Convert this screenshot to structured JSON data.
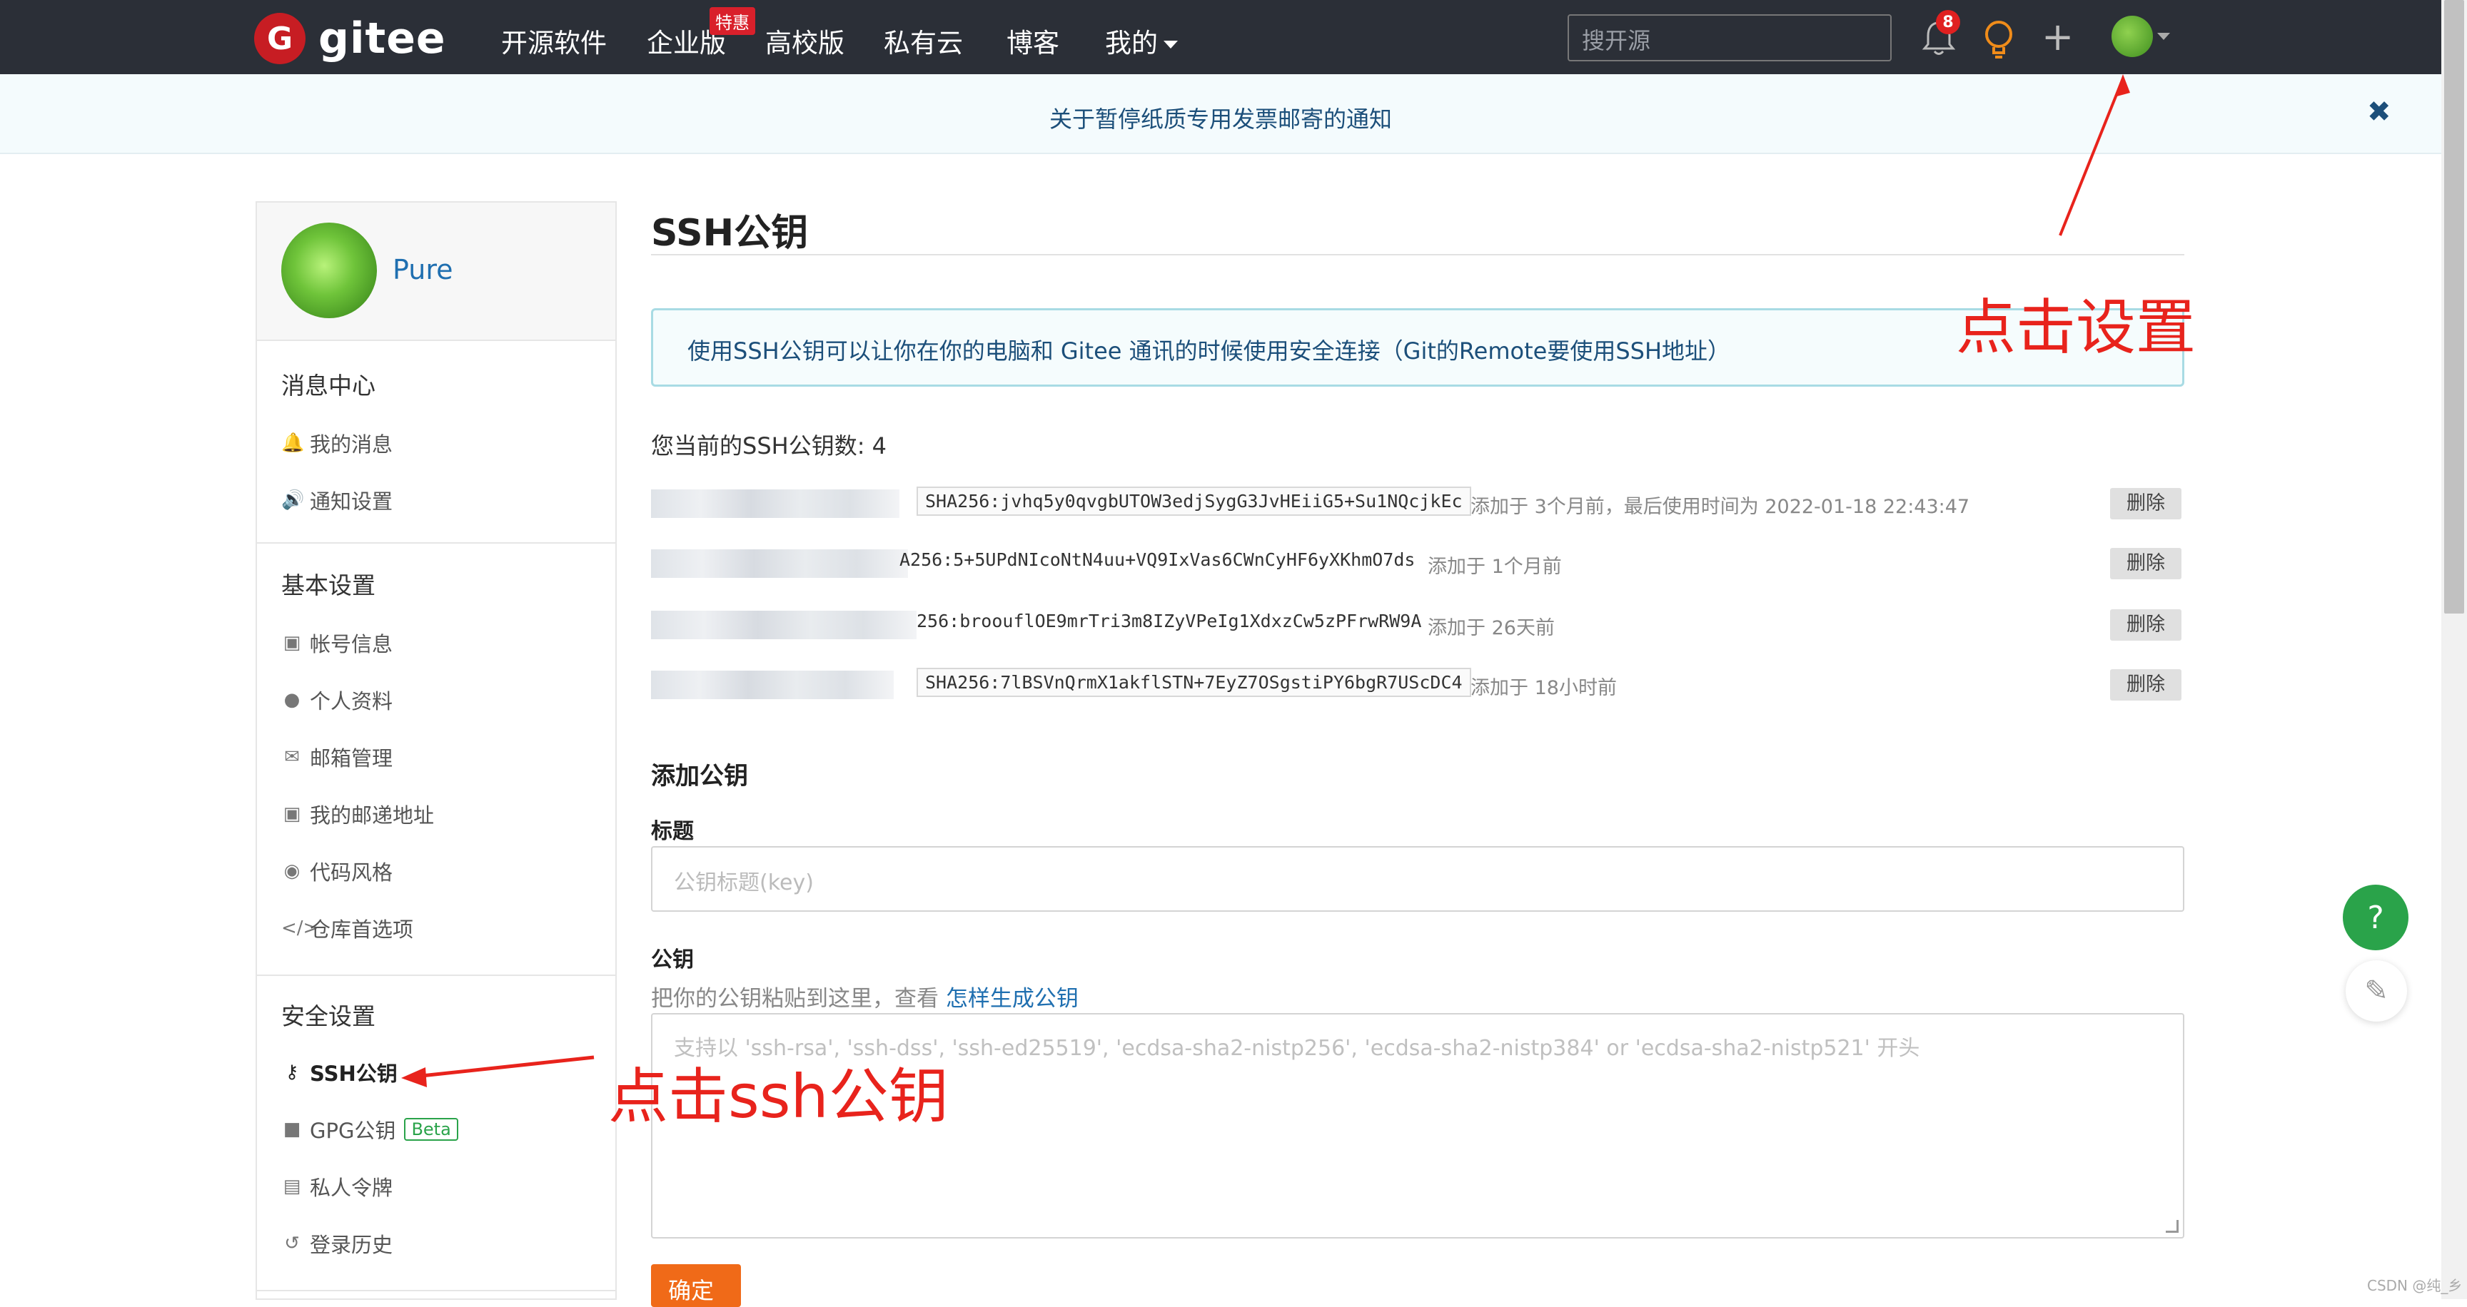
{
  "colors": {
    "accent": "#c71d23",
    "topbar": "#2b2f37",
    "link": "#1f6fb0",
    "annotation": "#e8231c",
    "submit": "#f06a18",
    "help": "#2aa34a"
  },
  "header": {
    "logo_letter": "G",
    "logo_text": "gitee",
    "nav": [
      "开源软件",
      "企业版",
      "高校版",
      "私有云",
      "博客"
    ],
    "enterprise_badge": "特惠",
    "my_menu": "我的",
    "search_placeholder": "搜开源",
    "notification_count": "8",
    "plus_icon": "+"
  },
  "notice": {
    "text": "关于暂停纸质专用发票邮寄的通知",
    "close": "✖"
  },
  "sidebar": {
    "username": "Pure",
    "sections": [
      {
        "title": "消息中心",
        "items": [
          {
            "icon": "bell-icon",
            "label": "我的消息"
          },
          {
            "icon": "volume-icon",
            "label": "通知设置"
          }
        ]
      },
      {
        "title": "基本设置",
        "items": [
          {
            "icon": "id-card-icon",
            "label": "帐号信息"
          },
          {
            "icon": "user-icon",
            "label": "个人资料"
          },
          {
            "icon": "mail-icon",
            "label": "邮箱管理"
          },
          {
            "icon": "address-icon",
            "label": "我的邮递地址"
          },
          {
            "icon": "palette-icon",
            "label": "代码风格"
          },
          {
            "icon": "code-icon",
            "label": "仓库首选项"
          }
        ]
      },
      {
        "title": "安全设置",
        "items": [
          {
            "icon": "key-icon",
            "label": "SSH公钥"
          },
          {
            "icon": "lock-icon",
            "label": "GPG公钥",
            "badge": "Beta"
          },
          {
            "icon": "token-icon",
            "label": "私人令牌"
          },
          {
            "icon": "history-icon",
            "label": "登录历史"
          }
        ]
      }
    ]
  },
  "main": {
    "title": "SSH公钥",
    "info": "使用SSH公钥可以让你在你的电脑和 Gitee 通讯的时候使用安全连接（Git的Remote要使用SSH地址）",
    "key_count": "您当前的SSH公钥数: 4",
    "keys": [
      {
        "fingerprint": "SHA256:jvhq5y0qvgbUTOW3edjSygG3JvHEiiG5+Su1NQcjkEc",
        "meta": "添加于 3个月前，最后使用时间为 2022-01-18 22:43:47",
        "delete": "删除"
      },
      {
        "fingerprint": "A256:5+5UPdNIcoNtN4uu+VQ9IxVas6CWnCyHF6yXKhmO7ds",
        "meta": "添加于 1个月前",
        "delete": "删除"
      },
      {
        "fingerprint": "256:broouflOE9mrTri3m8IZyVPeIg1XdxzCw5zPFrwRW9A",
        "meta": "添加于 26天前",
        "delete": "删除"
      },
      {
        "fingerprint": "SHA256:7lBSVnQrmX1akflSTN+7EyZ7OSgstiPY6bgR7UScDC4",
        "meta": "添加于 18小时前",
        "delete": "删除"
      }
    ],
    "add_title": "添加公钥",
    "title_label": "标题",
    "title_placeholder": "公钥标题(key)",
    "key_label": "公钥",
    "key_hint_prefix": "把你的公钥粘贴到这里，查看",
    "key_hint_link": "怎样生成公钥",
    "key_placeholder": "支持以 'ssh-rsa', 'ssh-dss', 'ssh-ed25519', 'ecdsa-sha2-nistp256', 'ecdsa-sha2-nistp384' or 'ecdsa-sha2-nistp521' 开头",
    "submit": "确定"
  },
  "floating": {
    "help": "?",
    "feedback_icon": "edit-icon"
  },
  "annotations": {
    "settings": "点击设置",
    "ssh": "点击ssh公钥"
  },
  "watermark": "CSDN @纯_乡"
}
